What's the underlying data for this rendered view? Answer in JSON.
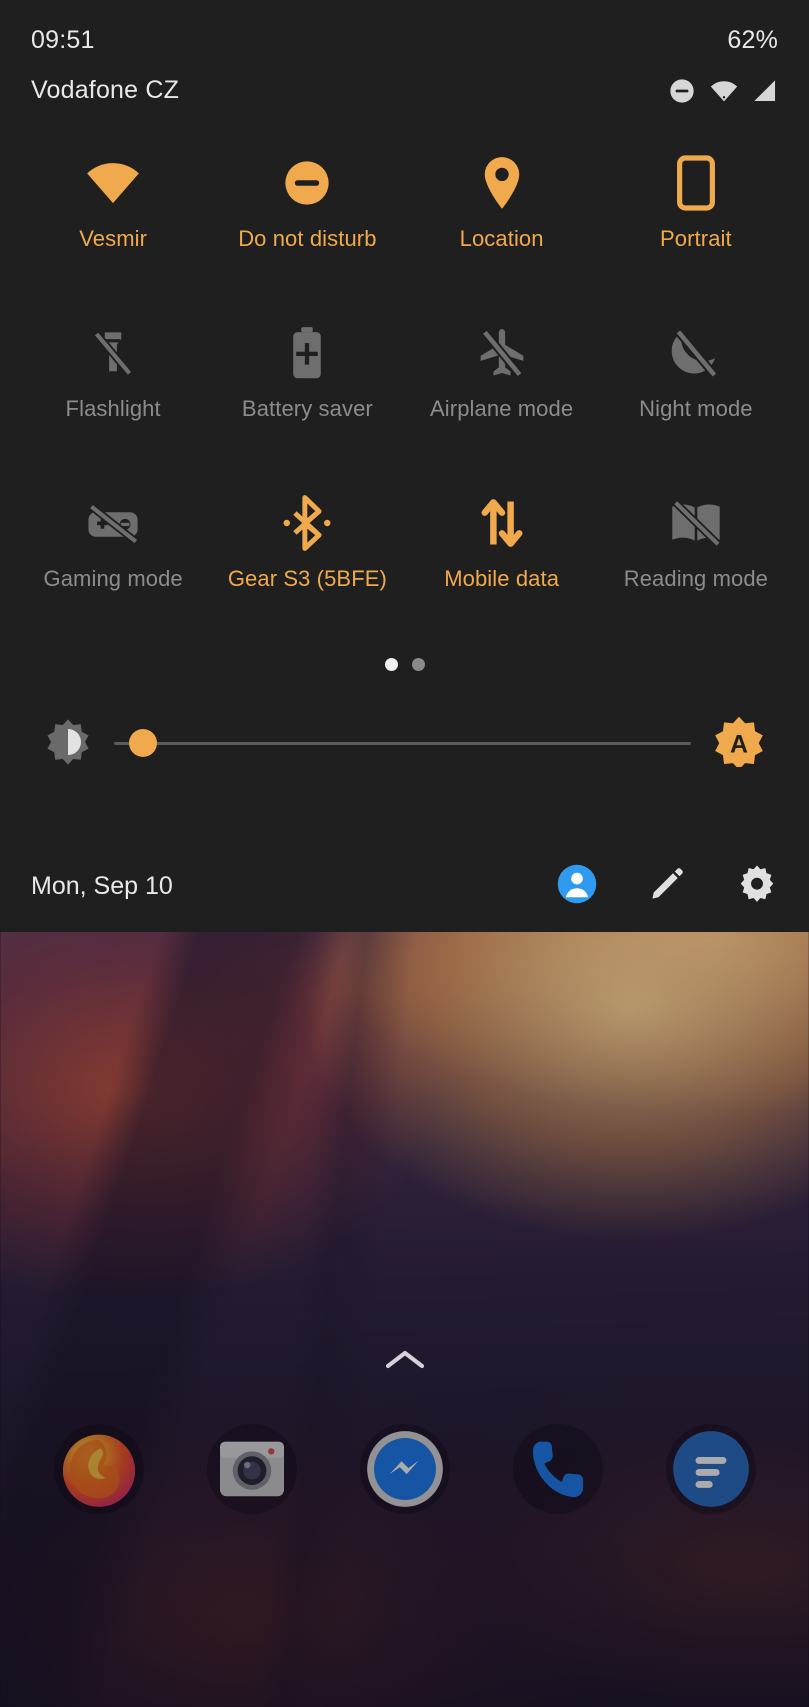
{
  "status_bar": {
    "time": "09:51",
    "battery_percent": "62%",
    "carrier": "Vodafone CZ",
    "icons": [
      "do-not-disturb-icon",
      "wifi-icon",
      "signal-icon"
    ]
  },
  "quick_settings": {
    "tiles": [
      [
        {
          "label": "Vesmir",
          "icon": "wifi-icon",
          "state": "on"
        },
        {
          "label": "Do not disturb",
          "icon": "do-not-disturb-icon",
          "state": "on"
        },
        {
          "label": "Location",
          "icon": "location-pin-icon",
          "state": "on"
        },
        {
          "label": "Portrait",
          "icon": "screen-rotation-icon",
          "state": "on"
        }
      ],
      [
        {
          "label": "Flashlight",
          "icon": "flashlight-off-icon",
          "state": "off"
        },
        {
          "label": "Battery saver",
          "icon": "battery-saver-icon",
          "state": "off"
        },
        {
          "label": "Airplane mode",
          "icon": "airplane-off-icon",
          "state": "off"
        },
        {
          "label": "Night mode",
          "icon": "night-mode-off-icon",
          "state": "off"
        }
      ],
      [
        {
          "label": "Gaming mode",
          "icon": "gamepad-off-icon",
          "state": "off"
        },
        {
          "label": "Gear S3 (5BFE)",
          "icon": "bluetooth-icon",
          "state": "on"
        },
        {
          "label": "Mobile data",
          "icon": "mobile-data-icon",
          "state": "on"
        },
        {
          "label": "Reading mode",
          "icon": "reading-mode-off-icon",
          "state": "off"
        }
      ]
    ],
    "pages": {
      "count": 2,
      "active_index": 0
    },
    "brightness": {
      "value_percent": 5,
      "low_icon": "brightness-low-icon",
      "auto_icon": "brightness-auto-icon",
      "auto_label": "A"
    },
    "footer": {
      "date": "Mon, Sep 10",
      "icons": [
        "user-avatar-icon",
        "edit-pencil-icon",
        "settings-gear-icon"
      ]
    }
  },
  "home_screen": {
    "app_drawer_handle": "chevron-up-icon",
    "dock": [
      {
        "name": "Firefox",
        "icon": "firefox-icon"
      },
      {
        "name": "Camera",
        "icon": "camera-icon"
      },
      {
        "name": "Messenger",
        "icon": "messenger-icon"
      },
      {
        "name": "Phone",
        "icon": "phone-icon"
      },
      {
        "name": "Messages",
        "icon": "messages-icon"
      }
    ]
  },
  "colors": {
    "accent_on": "#f0a94c",
    "tile_off": "#8c8c8c",
    "panel_bg": "#1f1f1f",
    "text": "#e8e8e8",
    "avatar_blue": "#2f9bf0"
  }
}
